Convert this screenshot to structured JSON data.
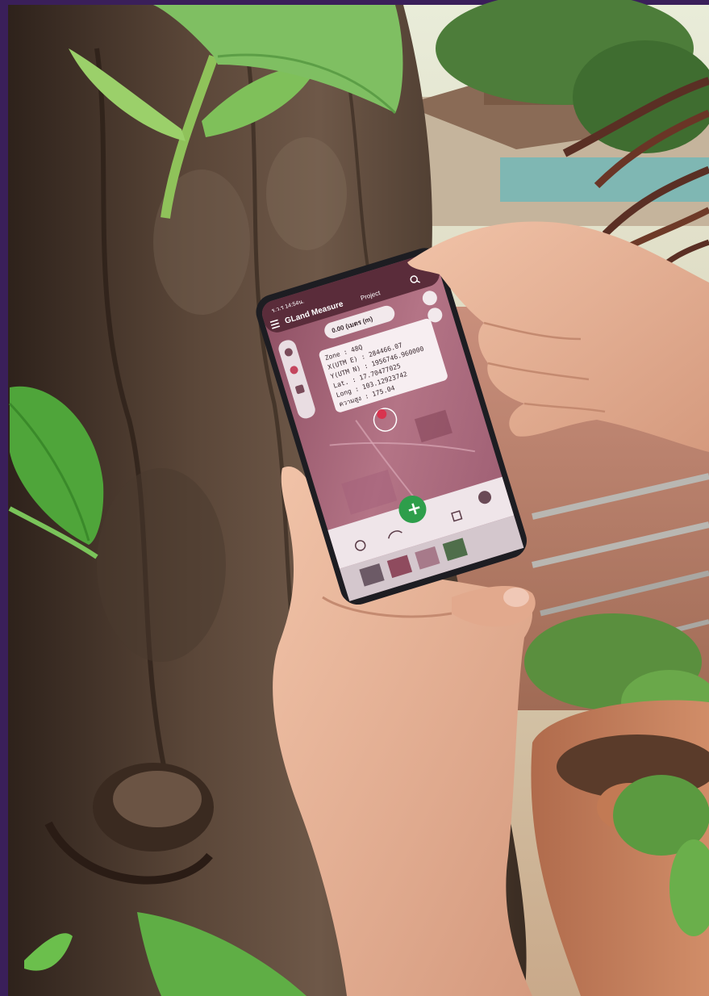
{
  "colors": {
    "frame": "#3a1f5a",
    "bark_dark": "#3f2f26",
    "bark_mid": "#6b5444",
    "leaf": "#5aa83c",
    "skin": "#e8b59a",
    "map_tint": "#b47486",
    "fab": "#2e9e4b"
  },
  "phone": {
    "status": "ร.ว.ร 14:54น.",
    "app_title": "GLand Measure",
    "project_label": "Project",
    "measure_mode": "0.00 (เมตร (m)",
    "info_lines": [
      "Zone : 48Q",
      "X(UTM E) : 284466.07",
      "Y(UTM N) : 1956746.960000",
      "Lat. : 17.70477025",
      "Long : 103.12923742",
      "ความสูง : 175.04"
    ],
    "fab_symbol": "+",
    "icons": [
      "menu-icon",
      "search-icon",
      "layers-icon",
      "gps-icon",
      "pin-icon",
      "undo-icon",
      "refresh-icon",
      "crosshair-icon"
    ]
  }
}
